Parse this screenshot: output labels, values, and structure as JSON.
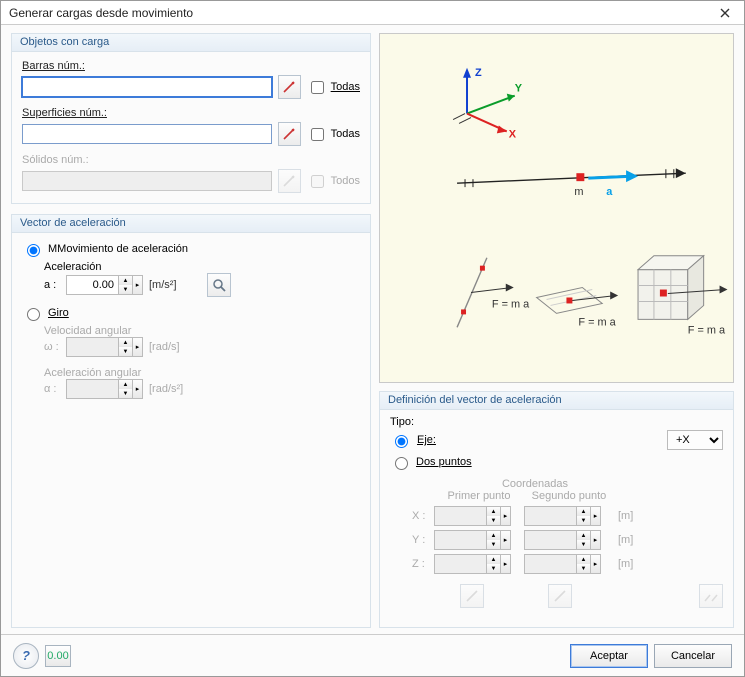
{
  "window": {
    "title": "Generar cargas desde movimiento"
  },
  "loaded_objects": {
    "title": "Objetos con carga",
    "members": {
      "label": "Barras núm.:",
      "value": "",
      "all_label": "Todas",
      "all_checked": false
    },
    "surfaces": {
      "label": "Superficies núm.:",
      "value": "",
      "all_label": "Todas",
      "all_checked": false
    },
    "solids": {
      "label": "Sólidos núm.:",
      "value": "",
      "all_label": "Todos",
      "all_checked": false,
      "enabled": false
    }
  },
  "accel_vector": {
    "title": "Vector de aceleración",
    "movement": {
      "label": "Movimiento de aceleración",
      "selected": true,
      "accel_caption": "Aceleración",
      "a_label": "a :",
      "a_value": "0.00",
      "a_unit": "[m/s²]"
    },
    "rotation": {
      "label": "Giro",
      "selected": false,
      "angular_velocity_caption": "Velocidad angular",
      "omega_label": "ω :",
      "omega_value": "",
      "omega_unit": "[rad/s]",
      "angular_accel_caption": "Aceleración angular",
      "alpha_label": "α :",
      "alpha_value": "",
      "alpha_unit": "[rad/s²]"
    }
  },
  "diagram": {
    "axes": {
      "x": "X",
      "y": "Y",
      "z": "Z"
    },
    "mass_label": "m",
    "accel_label": "a",
    "formula": "F = m a"
  },
  "definition": {
    "title": "Definición del vector de aceleración",
    "type_label": "Tipo:",
    "axis": {
      "label": "Eje:",
      "selected": true,
      "value": "+X"
    },
    "two_points": {
      "label": "Dos puntos",
      "selected": false
    },
    "coords": {
      "header": "Coordenadas",
      "first_point": "Primer punto",
      "second_point": "Segundo punto",
      "rows": [
        {
          "axis": "X :",
          "p1": "",
          "p2": "",
          "unit": "[m]"
        },
        {
          "axis": "Y :",
          "p1": "",
          "p2": "",
          "unit": "[m]"
        },
        {
          "axis": "Z :",
          "p1": "",
          "p2": "",
          "unit": "[m]"
        }
      ]
    }
  },
  "buttons": {
    "accept": "Aceptar",
    "cancel": "Cancelar"
  },
  "icons": {
    "help": "?",
    "units": "0.00"
  }
}
